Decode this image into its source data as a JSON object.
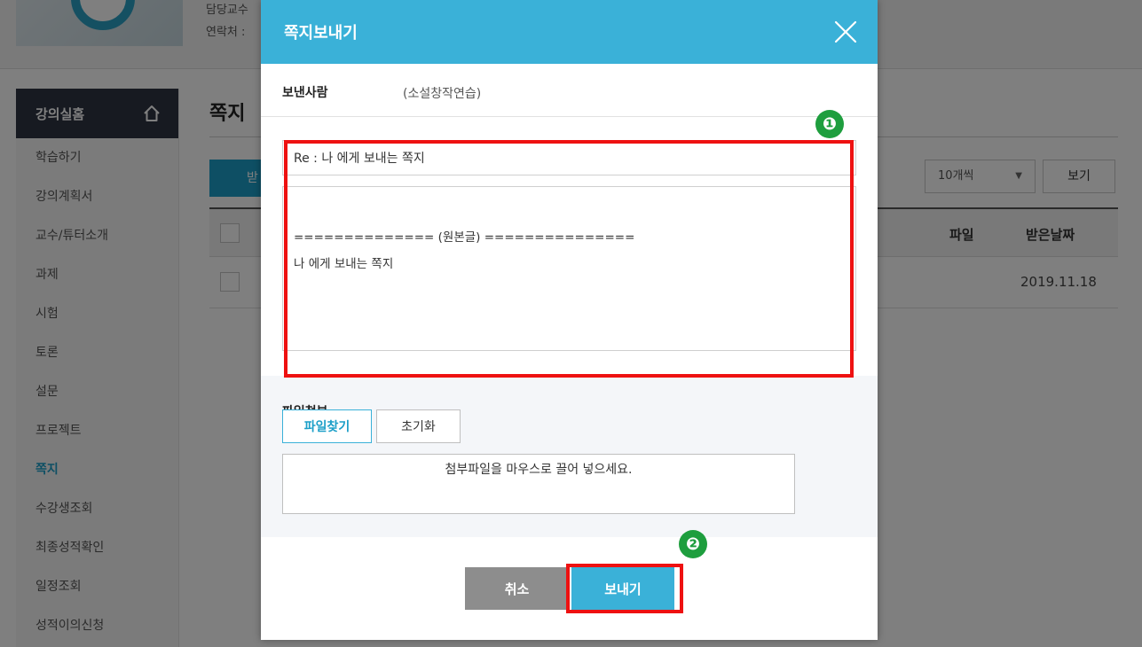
{
  "background": {
    "header_info_line1": "담당교수",
    "header_info_line2": "연락처 :",
    "sidebar_title": "강의실홈",
    "sidebar_items": [
      "학습하기",
      "강의계획서",
      "교수/튜터소개",
      "과제",
      "시험",
      "토론",
      "설문",
      "프로젝트",
      "쪽지",
      "수강생조회",
      "최종성적확인",
      "일정조회",
      "성적이의신청"
    ],
    "active_item": "쪽지",
    "page_title": "쪽지",
    "receive_button": "받",
    "page_size_select": "10개씩",
    "view_button": "보기",
    "table_headers": {
      "file": "파일",
      "date": "받은날짜"
    },
    "table_rows": [
      {
        "date": "2019.11.18"
      }
    ]
  },
  "modal": {
    "title": "쪽지보내기",
    "sender_label": "보낸사람",
    "sender_value": "(소설창작연습)",
    "subject_value": "Re : 나 에게 보내는 쪽지",
    "body_value": "\n============== (원본글) ===============\n나 에게 보내는 쪽지",
    "attach_label": "파일첨부",
    "find_file_button": "파일찾기",
    "reset_button": "초기화",
    "dropzone_text": "첨부파일을 마우스로 끌어 넣으세요.",
    "cancel_button": "취소",
    "send_button": "보내기"
  },
  "annotations": {
    "step1": "❶",
    "step2": "❷"
  },
  "colors": {
    "header_blue": "#3ab1d8",
    "highlight_red": "#ee1111",
    "badge_green": "#1e9e3e",
    "sidebar_dark": "#2f3442"
  }
}
